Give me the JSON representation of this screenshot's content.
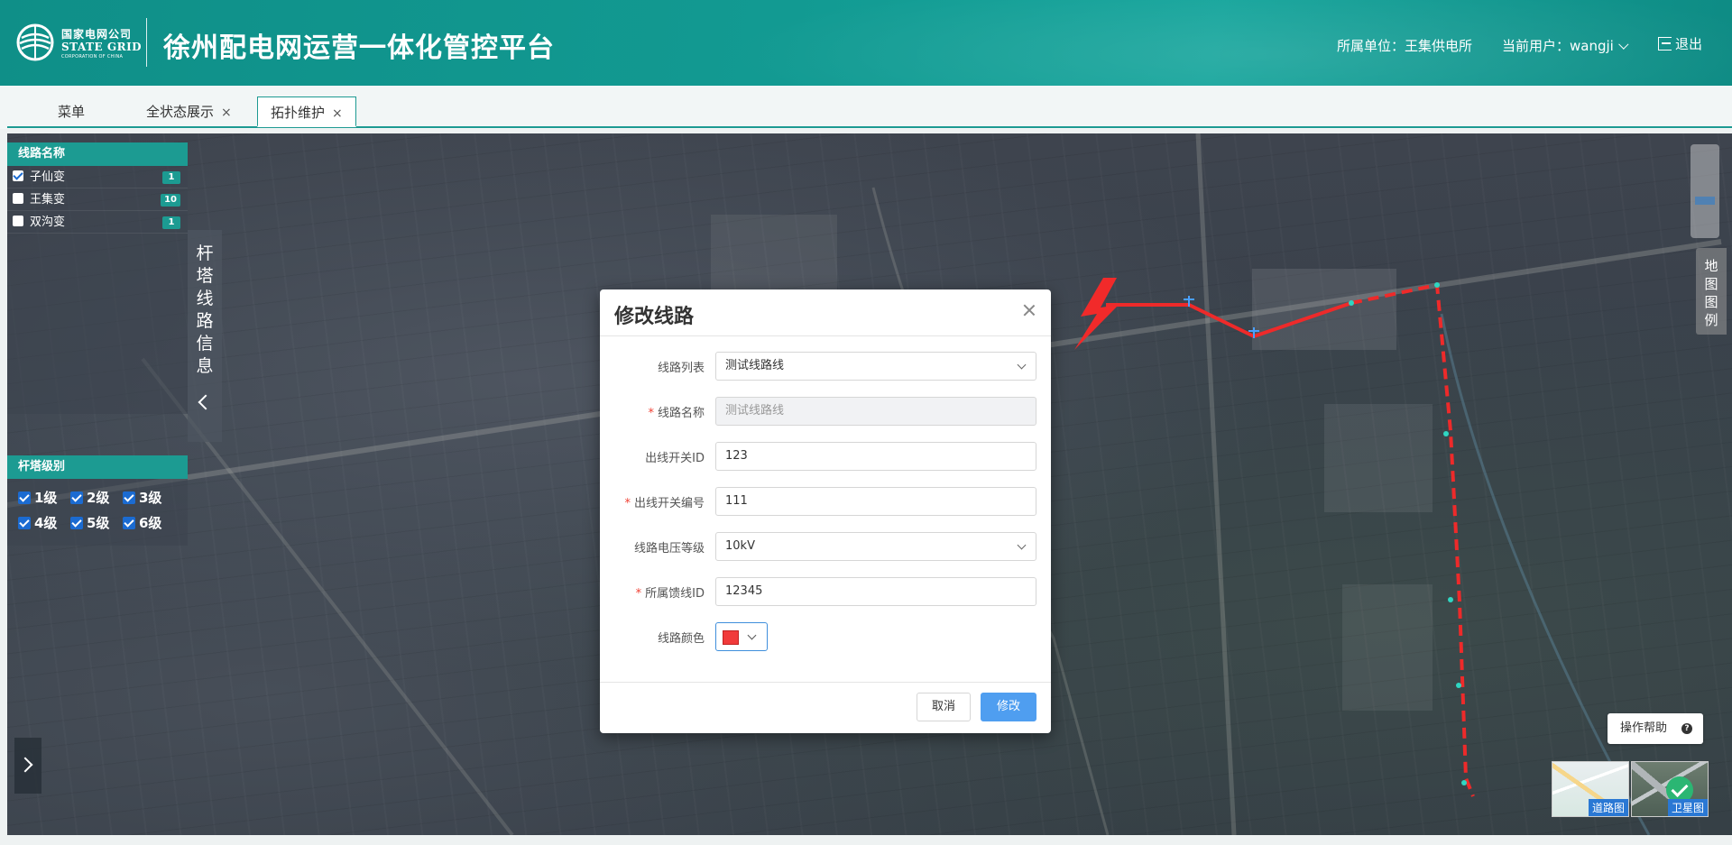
{
  "header": {
    "logo_cn": "国家电网公司",
    "logo_en": "STATE GRID",
    "logo_en_sub": "CORPORATION OF CHINA",
    "title": "徐州配电网运营一体化管控平台",
    "unit_label": "所属单位：王集供电所",
    "user_label": "当前用户：",
    "user_name": "wangji",
    "logout": "退出",
    "colors": {
      "header_bg": "#129a92",
      "accent": "#1c9b92"
    }
  },
  "tabs": [
    {
      "label": "菜单",
      "closable": false,
      "active": false
    },
    {
      "label": "全状态展示",
      "closable": true,
      "active": false
    },
    {
      "label": "拓扑维护",
      "closable": true,
      "active": true
    }
  ],
  "tab_close_glyph": "×",
  "lines_panel": {
    "title": "线路名称",
    "items": [
      {
        "name": "子仙变",
        "count": "1",
        "checked": true
      },
      {
        "name": "王集变",
        "count": "10",
        "checked": false
      },
      {
        "name": "双沟变",
        "count": "1",
        "checked": false
      }
    ]
  },
  "tower_info_tab": {
    "label": "杆塔线路信息"
  },
  "grade_panel": {
    "title": "杆塔级别",
    "grades": [
      "1级",
      "2级",
      "3级",
      "4级",
      "5级",
      "6级"
    ]
  },
  "legend_tab": {
    "label": "地图图例"
  },
  "help_button": {
    "label": "操作帮助",
    "icon": "question-icon"
  },
  "basemap": {
    "road": "道路图",
    "satellite": "卫星图",
    "selected": "卫星图"
  },
  "modal": {
    "title": "修改线路",
    "fields": [
      {
        "label": "线路列表",
        "value": "测试线路线",
        "required": false,
        "type": "select"
      },
      {
        "label": "线路名称",
        "value": "测试线路线",
        "required": true,
        "type": "disabled"
      },
      {
        "label": "出线开关ID",
        "value": "123",
        "required": false,
        "type": "text"
      },
      {
        "label": "出线开关编号",
        "value": "111",
        "required": true,
        "type": "text"
      },
      {
        "label": "线路电压等级",
        "value": "10kV",
        "required": false,
        "type": "select"
      },
      {
        "label": "所属馈线ID",
        "value": "12345",
        "required": true,
        "type": "text"
      },
      {
        "label": "线路颜色",
        "value": "#f13a3a",
        "required": false,
        "type": "color"
      }
    ],
    "cancel": "取消",
    "submit": "修改",
    "line_color": "#f13a3a"
  }
}
